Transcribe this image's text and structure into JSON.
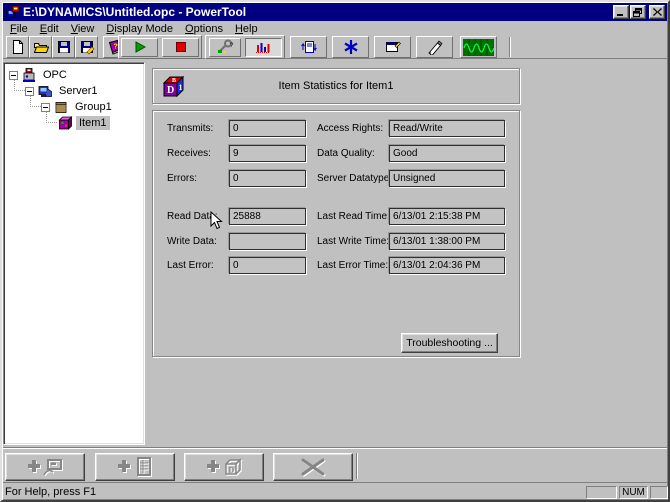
{
  "window": {
    "title": "E:\\DYNAMICS\\Untitled.opc - PowerTool"
  },
  "menu": {
    "items": [
      "File",
      "Edit",
      "View",
      "Display Mode",
      "Options",
      "Help"
    ]
  },
  "toolbar": {
    "icons": [
      "new-document",
      "open-file",
      "save",
      "save-as",
      "help-book",
      "start-monitoring",
      "stop-monitoring",
      "server-tools",
      "item-statistics",
      "item-update",
      "options-asterisk",
      "properties",
      "write-pen",
      "monitor-scope"
    ],
    "active_icon": "item-statistics"
  },
  "tree": {
    "items": [
      {
        "label": "OPC",
        "level": 0,
        "expanded": true,
        "selected": false
      },
      {
        "label": "Server1",
        "level": 1,
        "expanded": true,
        "selected": false
      },
      {
        "label": "Group1",
        "level": 2,
        "expanded": true,
        "selected": false
      },
      {
        "label": "Item1",
        "level": 3,
        "expanded": false,
        "selected": true
      }
    ]
  },
  "panel": {
    "title": "Item Statistics for Item1",
    "stats_left": [
      {
        "label": "Transmits:",
        "value": "0"
      },
      {
        "label": "Receives:",
        "value": "9"
      },
      {
        "label": "Errors:",
        "value": "0"
      },
      {
        "label": "Read Data:",
        "value": "25888"
      },
      {
        "label": "Write Data:",
        "value": ""
      },
      {
        "label": "Last Error:",
        "value": "0"
      }
    ],
    "stats_right": [
      {
        "label": "Access Rights:",
        "value": "Read/Write"
      },
      {
        "label": "Data Quality:",
        "value": "Good"
      },
      {
        "label": "Server Datatype:",
        "value": "Unsigned"
      },
      {
        "label": "Last Read Time:",
        "value": "6/13/01 2:15:38 PM"
      },
      {
        "label": "Last Write Time:",
        "value": "6/13/01 1:38:00 PM"
      },
      {
        "label": "Last Error Time:",
        "value": "6/13/01 2:04:36 PM"
      }
    ],
    "troubleshooting_label": "Troubleshooting ..."
  },
  "bottom_toolbar": {
    "buttons": [
      {
        "name": "add-server",
        "disabled": true
      },
      {
        "name": "add-group",
        "disabled": true
      },
      {
        "name": "add-item",
        "disabled": true
      },
      {
        "name": "delete",
        "disabled": true
      }
    ]
  },
  "status_bar": {
    "help_text": "For Help, press F1",
    "num_indicator": "NUM"
  },
  "colors": {
    "titlebar": "#000080",
    "face": "#c0c0c0",
    "shadow": "#808080",
    "highlight": "#ffffff",
    "tree_background": "#ffffff",
    "selection": "#c0c0c0",
    "scope_green": "#007000"
  }
}
